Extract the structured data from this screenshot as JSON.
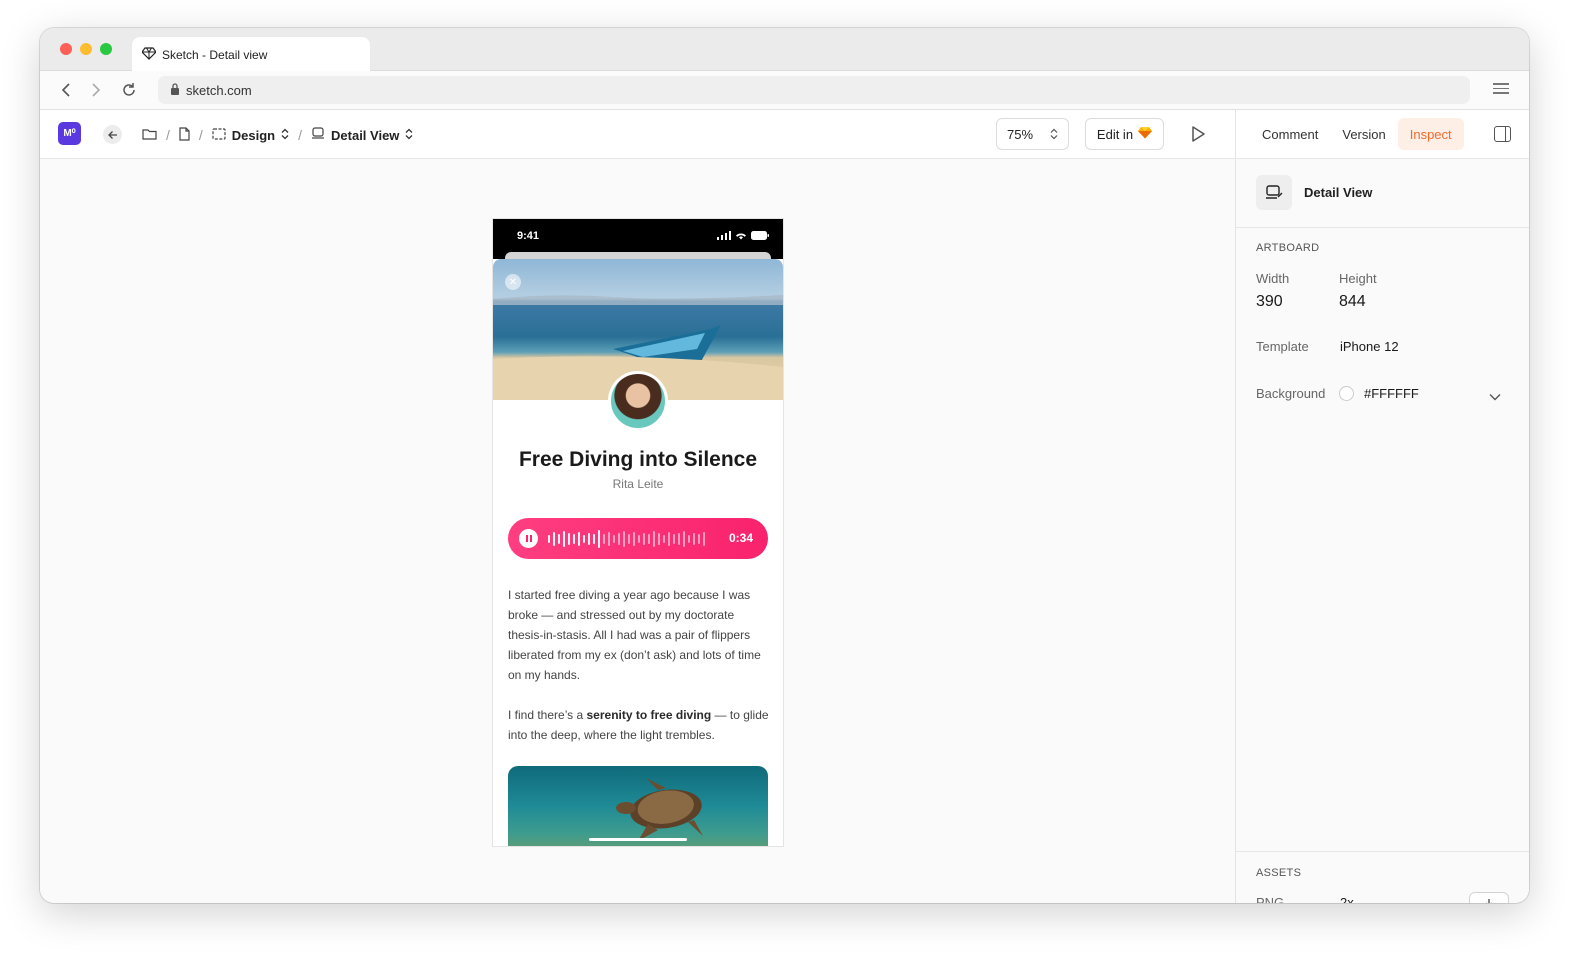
{
  "browser": {
    "tab_title": "Sketch - Detail view",
    "url": "sketch.com"
  },
  "toolbar": {
    "logo_text": "M⁰",
    "breadcrumb": {
      "design": "Design",
      "detail_view": "Detail View"
    },
    "zoom": "75%",
    "edit_in_label": "Edit in"
  },
  "inspector": {
    "tabs": [
      "Comment",
      "Version",
      "Inspect"
    ],
    "active_tab": "Inspect",
    "title": "Detail View",
    "artboard_section": "ARTBOARD",
    "width_label": "Width",
    "width_value": "390",
    "height_label": "Height",
    "height_value": "844",
    "template_label": "Template",
    "template_value": "iPhone 12",
    "background_label": "Background",
    "background_value": "#FFFFFF",
    "assets_section": "ASSETS",
    "asset_format": "PNG",
    "asset_scale": "2x"
  },
  "artboard": {
    "status_time": "9:41",
    "title": "Free Diving into Silence",
    "author": "Rita Leite",
    "player_time": "0:34",
    "paragraph1": "I started free diving a year ago because I was broke — and stressed out by my doctorate thesis-in-stasis. All I had was a pair of flippers liberated from my ex (don’t ask) and lots of time on my hands.",
    "paragraph2_before": "I find there’s a ",
    "paragraph2_bold": "serenity to free diving",
    "paragraph2_after": " — to glide into the deep, where the light trembles."
  },
  "colors": {
    "accent_inspect": "#ef6c2f",
    "player_pink": "#f9226d",
    "logo_purple": "#5a3ae0"
  }
}
